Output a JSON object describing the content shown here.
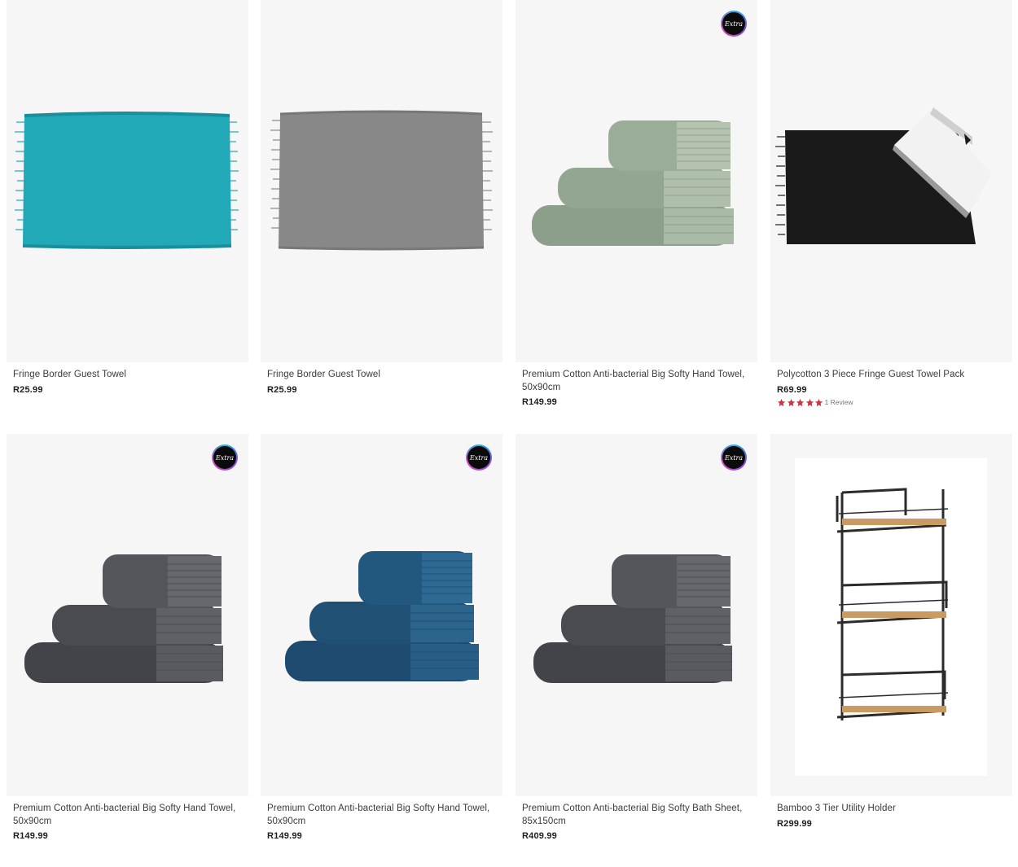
{
  "products": [
    {
      "title": "Fringe Border Guest Towel",
      "price": "R25.99",
      "image_icon": "teal-fringe-towel-icon",
      "color": "#21a9b8"
    },
    {
      "title": "Fringe Border Guest Towel",
      "price": "R25.99",
      "image_icon": "grey-fringe-towel-icon",
      "color": "#888888"
    },
    {
      "title": "Premium Cotton Anti-bacterial Big Softy Hand Towel, 50x90cm",
      "price": "R149.99",
      "badge": "Extra",
      "image_icon": "sage-towel-stack-icon",
      "color": "#8fa48f"
    },
    {
      "title": "Polycotton 3 Piece Fringe Guest Towel Pack",
      "price": "R69.99",
      "rating": 5,
      "review_text": "1 Review",
      "image_icon": "black-white-towel-pack-icon",
      "color": "#1a1a1a"
    },
    {
      "title": "Premium Cotton Anti-bacterial Big Softy Hand Towel, 50x90cm",
      "price": "R149.99",
      "badge": "Extra",
      "image_icon": "charcoal-towel-stack-icon",
      "color": "#4a4b4f"
    },
    {
      "title": "Premium Cotton Anti-bacterial Big Softy Hand Towel, 50x90cm",
      "price": "R149.99",
      "badge": "Extra",
      "image_icon": "navy-towel-stack-icon",
      "color": "#1f4e73"
    },
    {
      "title": "Premium Cotton Anti-bacterial Big Softy Bath Sheet, 85x150cm",
      "price": "R409.99",
      "badge": "Extra",
      "image_icon": "charcoal-towel-stack-icon",
      "color": "#4a4b4f"
    },
    {
      "title": "Bamboo 3 Tier Utility Holder",
      "price": "R299.99",
      "image_icon": "bamboo-shelf-icon",
      "color": "#c99b62"
    }
  ],
  "colors": {
    "star": "#d32f3d",
    "image_bg": "#f6f6f6"
  }
}
